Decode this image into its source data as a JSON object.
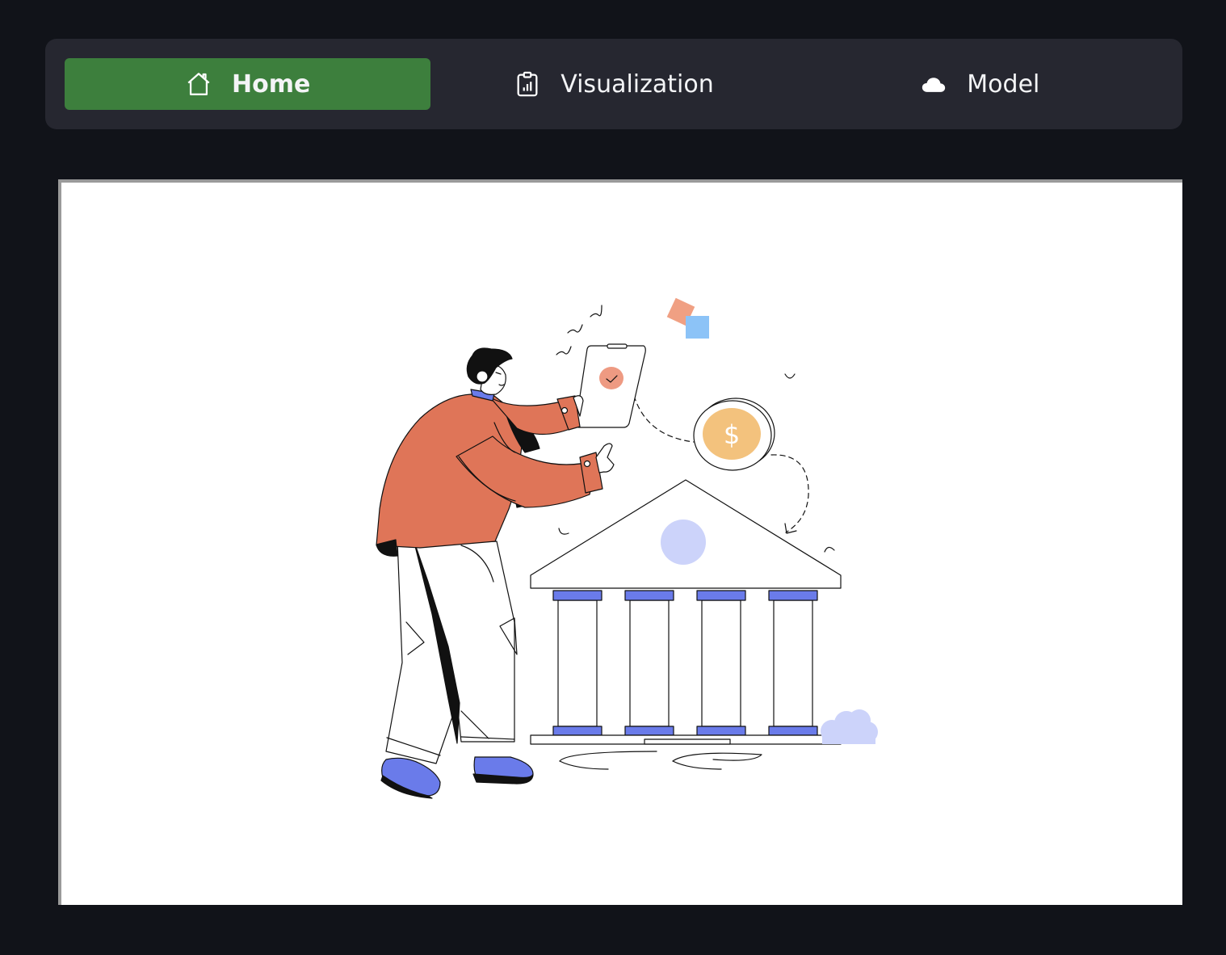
{
  "nav": {
    "items": [
      {
        "label": "Home",
        "icon": "house-icon",
        "active": true
      },
      {
        "label": "Visualization",
        "icon": "clipboard-chart-icon",
        "active": false
      },
      {
        "label": "Model",
        "icon": "cloud-icon",
        "active": false
      }
    ]
  },
  "colors": {
    "page_background": "#111319",
    "navbar_background": "#262730",
    "active_tab": "#3d7f3d",
    "frame_background": "#ffffff",
    "jacket": "#df7558",
    "accent_blue": "#6a7bea",
    "light_lavender": "#ccd3fa",
    "coin": "#f3c27d"
  }
}
